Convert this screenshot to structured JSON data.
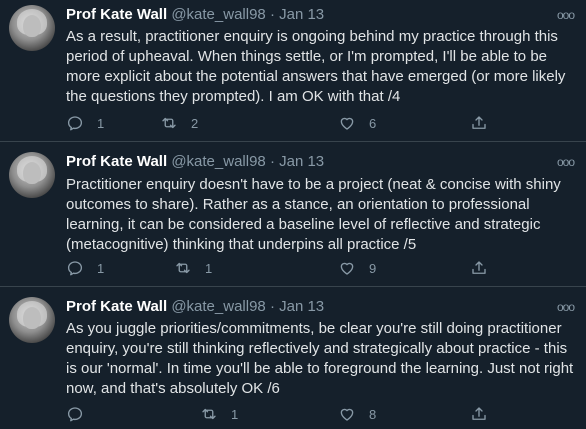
{
  "tweets": [
    {
      "author_name": "Prof Kate Wall",
      "handle": "@kate_wall98",
      "separator": "·",
      "date": "Jan 13",
      "more": "ooo",
      "text": "As a result, practitioner enquiry is ongoing behind my practice through this period of upheaval.  When things settle, or I'm prompted, I'll be able to be more explicit about the potential answers that have emerged (or more likely the questions they prompted). I am OK with that /4",
      "replies": "1",
      "retweets": "2",
      "likes": "6"
    },
    {
      "author_name": "Prof Kate Wall",
      "handle": "@kate_wall98",
      "separator": "·",
      "date": "Jan 13",
      "more": "ooo",
      "text": "Practitioner enquiry doesn't have to be a project (neat & concise with shiny outcomes to share).  Rather as a stance, an orientation to professional learning, it can be considered a baseline level of reflective and strategic (metacognitive) thinking that underpins all practice /5",
      "replies": "1",
      "retweets": "1",
      "likes": "9"
    },
    {
      "author_name": "Prof Kate Wall",
      "handle": "@kate_wall98",
      "separator": "·",
      "date": "Jan 13",
      "more": "ooo",
      "text": "As you juggle priorities/commitments, be clear you're still doing practitioner enquiry, you're still thinking reflectively and strategically about practice - this is our 'normal'. In time you'll be able to foreground the learning. Just not right now, and that's absolutely OK /6",
      "replies": "",
      "retweets": "1",
      "likes": "8"
    }
  ],
  "colors": {
    "background": "#15202b",
    "secondary_text": "#8899a6",
    "divider": "#38444d"
  },
  "icons": [
    "reply-icon",
    "retweet-icon",
    "like-icon",
    "share-icon",
    "more-icon"
  ]
}
